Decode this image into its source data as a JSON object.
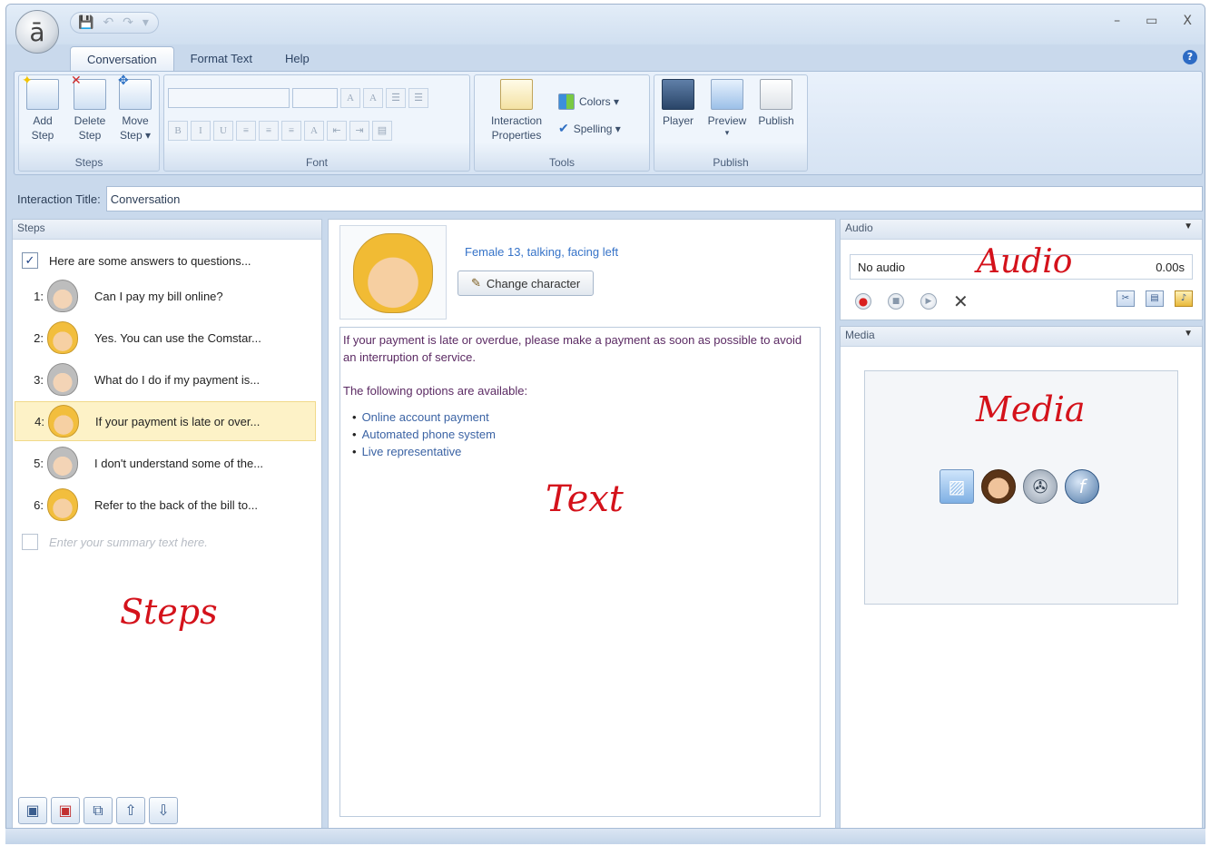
{
  "app": {
    "orb_glyph": "ā"
  },
  "window_controls": {
    "minimize": "–",
    "maximize": "▭",
    "close": "X"
  },
  "tabs": [
    {
      "label": "Conversation",
      "active": true
    },
    {
      "label": "Format Text",
      "active": false
    },
    {
      "label": "Help",
      "active": false
    }
  ],
  "ribbon": {
    "steps_group": {
      "label": "Steps",
      "add": "Add\nStep",
      "add_l1": "Add",
      "add_l2": "Step",
      "delete_l1": "Delete",
      "delete_l2": "Step",
      "move_l1": "Move",
      "move_l2": "Step ▾"
    },
    "font_group": {
      "label": "Font"
    },
    "tools_group": {
      "label": "Tools",
      "interaction_l1": "Interaction",
      "interaction_l2": "Properties",
      "colors": "Colors ▾",
      "spelling": "Spelling ▾"
    },
    "publish_group": {
      "label": "Publish",
      "player": "Player",
      "preview": "Preview",
      "preview_caret": "▾",
      "publish": "Publish"
    }
  },
  "interaction_title": {
    "label": "Interaction Title:",
    "value": "Conversation"
  },
  "steps_panel": {
    "title": "Steps",
    "intro": "Here are some answers to questions...",
    "items": [
      {
        "num": "1:",
        "text": "Can I pay my bill online?",
        "avatar": "old"
      },
      {
        "num": "2:",
        "text": "Yes. You can use the Comstar...",
        "avatar": "young"
      },
      {
        "num": "3:",
        "text": "What do I do if my payment is...",
        "avatar": "old"
      },
      {
        "num": "4:",
        "text": "If your payment is late or over...",
        "avatar": "young",
        "selected": true
      },
      {
        "num": "5:",
        "text": "I don't understand some of the...",
        "avatar": "old"
      },
      {
        "num": "6:",
        "text": "Refer to the back of the bill to...",
        "avatar": "young"
      }
    ],
    "summary_placeholder": "Enter your summary text here.",
    "annotation": "Steps"
  },
  "text_panel": {
    "character_desc": "Female 13,  talking,  facing left",
    "change_button": "Change character",
    "para1": "If your payment is late or overdue, please make a payment as soon as possible to avoid an interruption of service.",
    "para2": "The following options are available:",
    "options": [
      "Online account payment",
      "Automated phone system",
      "Live representative"
    ],
    "annotation": "Text"
  },
  "audio_panel": {
    "title": "Audio",
    "status": "No audio",
    "duration": "0.00s",
    "annotation": "Audio"
  },
  "media_panel": {
    "title": "Media",
    "annotation": "Media"
  },
  "colors": {
    "accent": "#2d6bc4",
    "annotation": "#d4121b",
    "selected_row": "#fdf2c7"
  }
}
